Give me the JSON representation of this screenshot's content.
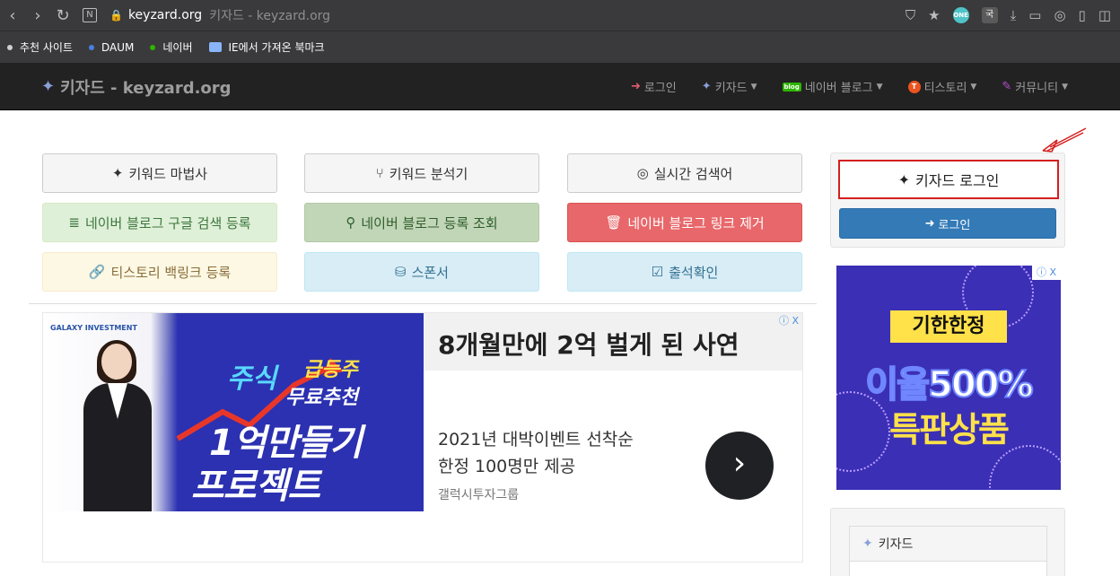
{
  "browser": {
    "domain": "keyzard.org",
    "page_title": "키자드 - keyzard.org",
    "bookmarks": [
      {
        "label": "추천 사이트",
        "color": "#cfcfcf"
      },
      {
        "label": "DAUM",
        "color": "#4a7fe0"
      },
      {
        "label": "네이버",
        "color": "#2db400"
      },
      {
        "label": "IE에서 가져온 북마크",
        "color": "#8ab4f8"
      }
    ]
  },
  "navbar": {
    "brand": "키자드 - keyzard.org",
    "items": [
      {
        "label": "로그인"
      },
      {
        "label": "키자드"
      },
      {
        "label": "네이버 블로그"
      },
      {
        "label": "티스토리"
      },
      {
        "label": "커뮤니티"
      }
    ]
  },
  "buttons": [
    {
      "label": "키워드 마법사"
    },
    {
      "label": "키워드 분석기"
    },
    {
      "label": "실시간 검색어"
    },
    {
      "label": "네이버 블로그 구글 검색 등록"
    },
    {
      "label": "네이버 블로그 등록 조회"
    },
    {
      "label": "네이버 블로그 링크 제거"
    },
    {
      "label": "티스토리 백링크 등록"
    },
    {
      "label": "스폰서"
    },
    {
      "label": "출석확인"
    }
  ],
  "ad": {
    "logo": "GALAXY INVESTMENT",
    "img_text_1": "주식",
    "img_text_2": "급등주",
    "img_text_3": "무료추천",
    "img_text_4": "1억만들기",
    "img_text_5": "프로젝트",
    "headline": "8개월만에 2억 벌게 된 사연",
    "body1": "2021년 대박이벤트 선착순",
    "body2": "한정 100명만 제공",
    "brand": "갤럭시투자그룹",
    "info": "ⓘ X"
  },
  "sidebar": {
    "panel_title": "키자드 로그인",
    "login_button": "로그인",
    "side_ad": {
      "tag": "기한한정",
      "line1": "이율500%",
      "line2": "특판상품",
      "info": "ⓘ X"
    },
    "widget_title": "키자드"
  }
}
